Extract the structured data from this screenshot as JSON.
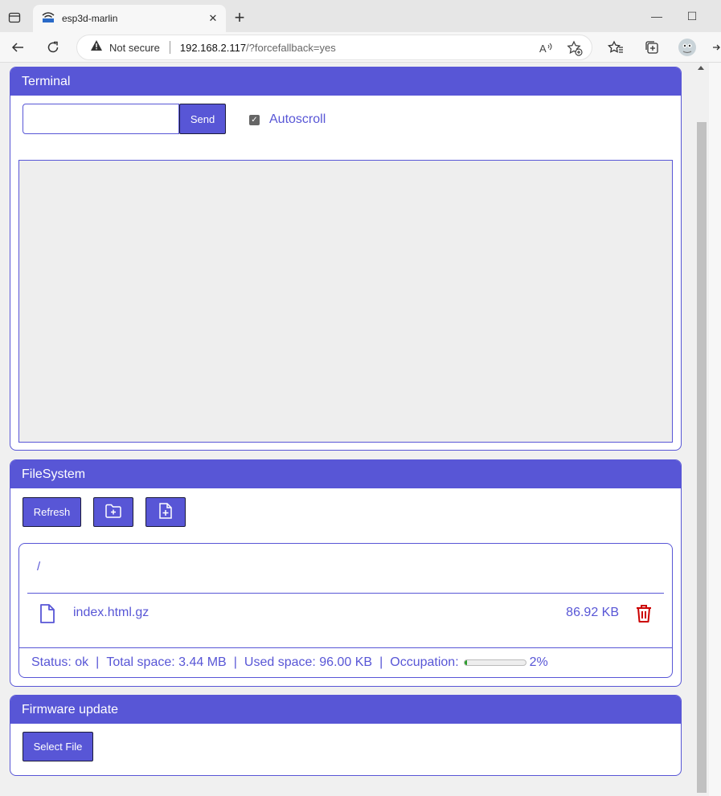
{
  "browser": {
    "tab_title": "esp3d-marlin",
    "tab_close": "✕",
    "new_tab": "+",
    "minimize": "—",
    "maximize": "☐",
    "not_secure": "Not secure",
    "url_host": "192.168.2.117",
    "url_rest": "/?forcefallback=yes"
  },
  "terminal": {
    "title": "Terminal",
    "command_value": "",
    "send_label": "Send",
    "autoscroll_label": "Autoscroll",
    "autoscroll_checked": true,
    "output": ""
  },
  "filesystem": {
    "title": "FileSystem",
    "refresh_label": "Refresh",
    "new_folder_icon": "folder-plus-icon",
    "upload_file_icon": "file-plus-icon",
    "path": "/",
    "files": [
      {
        "name": "index.html.gz",
        "size": "86.92 KB"
      }
    ],
    "status": {
      "status": "Status: ok",
      "sep1": "|",
      "total": "Total space: 3.44 MB",
      "sep2": "|",
      "used": "Used space: 96.00 KB",
      "sep3": "|",
      "occupation_label": "Occupation:",
      "occupation_value": "2%",
      "occupation_fraction": 0.02
    }
  },
  "firmware": {
    "title": "Firmware update",
    "select_label": "Select File"
  },
  "colors": {
    "accent": "#5856d6",
    "delete": "#cc0000",
    "progress": "#2a9d2a"
  }
}
